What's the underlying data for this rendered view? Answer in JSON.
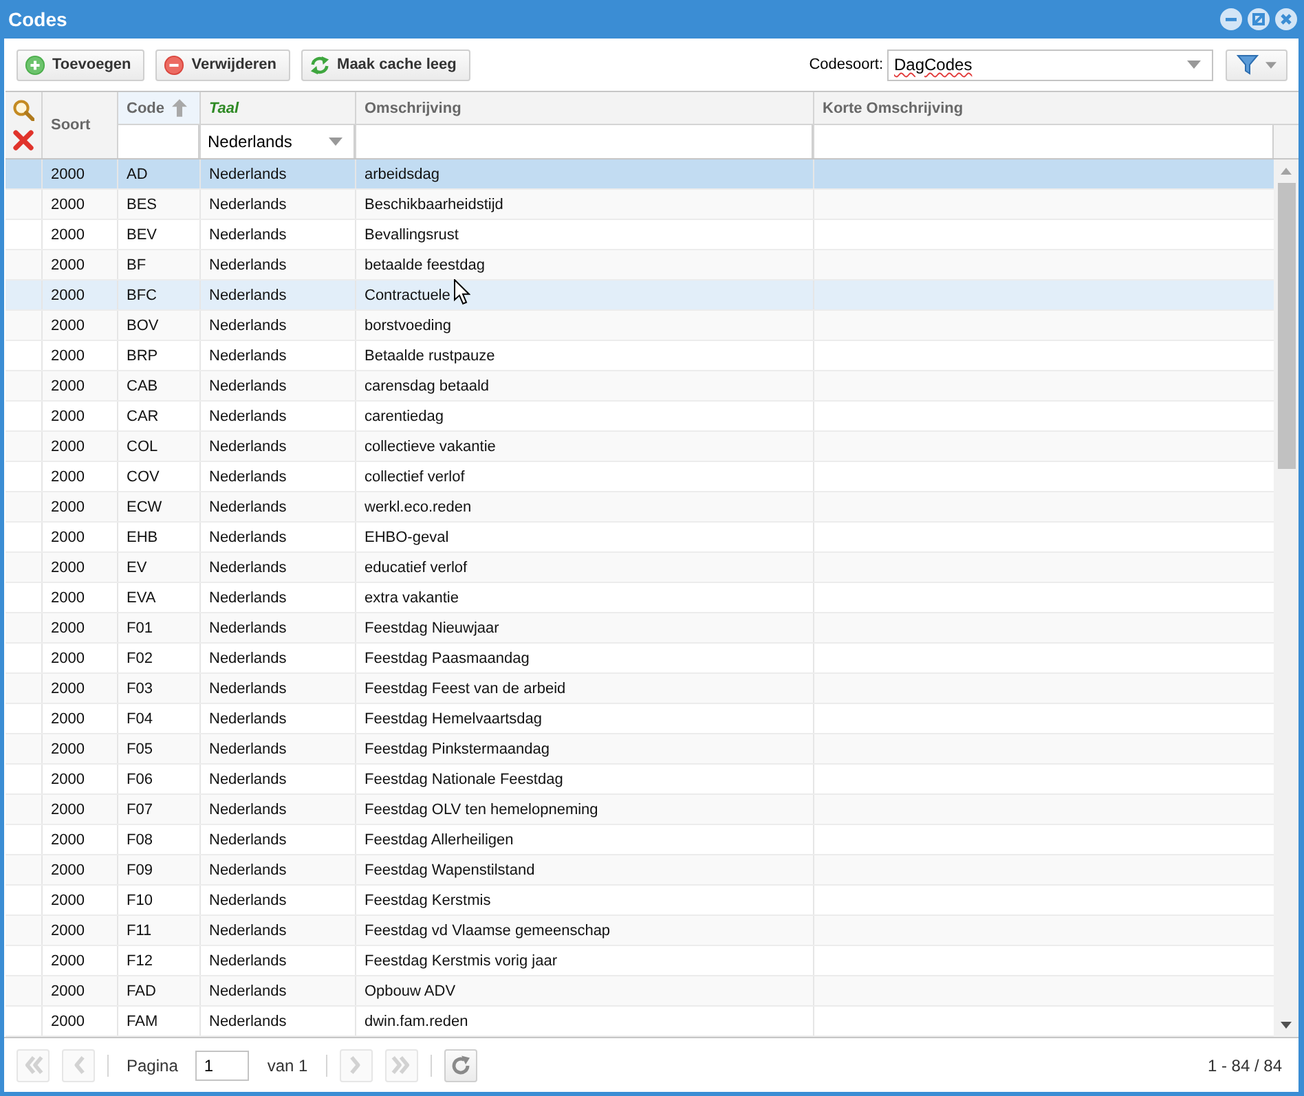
{
  "window": {
    "title": "Codes"
  },
  "toolbar": {
    "buttons": [
      {
        "label": "Toevoegen",
        "kind": "add"
      },
      {
        "label": "Verwijderen",
        "kind": "delete"
      },
      {
        "label": "Maak cache leeg",
        "kind": "refresh"
      }
    ],
    "code_type": {
      "label": "Codesoort:",
      "value": "DagCodes"
    }
  },
  "table": {
    "columns": [
      {
        "label": "Soort",
        "sorted": false,
        "filtered": false
      },
      {
        "label": "Code",
        "filter": {
          "kind": "text"
        },
        "sorted": true,
        "filtered": false
      },
      {
        "label": "Taal",
        "filter": {
          "kind": "select",
          "value": "Nederlands"
        },
        "sorted": false,
        "filtered": true
      },
      {
        "label": "Omschrijving",
        "filter": {
          "kind": "text"
        },
        "sorted": false,
        "filtered": false
      },
      {
        "label": "Korte Omschrijving",
        "filter": {
          "kind": "text"
        },
        "sorted": false,
        "filtered": false
      }
    ],
    "rows": [
      {
        "cells": [
          "2000",
          "AD",
          "Nederlands",
          "arbeidsdag"
        ],
        "selected": true,
        "hovered": false
      },
      {
        "cells": [
          "2000",
          "BES",
          "Nederlands",
          "Beschikbaarheidstijd"
        ],
        "selected": false,
        "hovered": false
      },
      {
        "cells": [
          "2000",
          "BEV",
          "Nederlands",
          "Bevallingsrust"
        ],
        "selected": false,
        "hovered": false
      },
      {
        "cells": [
          "2000",
          "BF",
          "Nederlands",
          "betaalde feestdag"
        ],
        "selected": false,
        "hovered": false
      },
      {
        "cells": [
          "2000",
          "BFC",
          "Nederlands",
          "Contractuele"
        ],
        "selected": false,
        "hovered": true
      },
      {
        "cells": [
          "2000",
          "BOV",
          "Nederlands",
          "borstvoeding"
        ],
        "selected": false,
        "hovered": false
      },
      {
        "cells": [
          "2000",
          "BRP",
          "Nederlands",
          "Betaalde rustpauze"
        ],
        "selected": false,
        "hovered": false
      },
      {
        "cells": [
          "2000",
          "CAB",
          "Nederlands",
          "carensdag betaald"
        ],
        "selected": false,
        "hovered": false
      },
      {
        "cells": [
          "2000",
          "CAR",
          "Nederlands",
          "carentiedag"
        ],
        "selected": false,
        "hovered": false
      },
      {
        "cells": [
          "2000",
          "COL",
          "Nederlands",
          "collectieve vakantie"
        ],
        "selected": false,
        "hovered": false
      },
      {
        "cells": [
          "2000",
          "COV",
          "Nederlands",
          "collectief verlof"
        ],
        "selected": false,
        "hovered": false
      },
      {
        "cells": [
          "2000",
          "ECW",
          "Nederlands",
          "werkl.eco.reden"
        ],
        "selected": false,
        "hovered": false
      },
      {
        "cells": [
          "2000",
          "EHB",
          "Nederlands",
          "EHBO-geval"
        ],
        "selected": false,
        "hovered": false
      },
      {
        "cells": [
          "2000",
          "EV",
          "Nederlands",
          "educatief verlof"
        ],
        "selected": false,
        "hovered": false
      },
      {
        "cells": [
          "2000",
          "EVA",
          "Nederlands",
          "extra vakantie"
        ],
        "selected": false,
        "hovered": false
      },
      {
        "cells": [
          "2000",
          "F01",
          "Nederlands",
          "Feestdag Nieuwjaar"
        ],
        "selected": false,
        "hovered": false
      },
      {
        "cells": [
          "2000",
          "F02",
          "Nederlands",
          "Feestdag Paasmaandag"
        ],
        "selected": false,
        "hovered": false
      },
      {
        "cells": [
          "2000",
          "F03",
          "Nederlands",
          "Feestdag Feest van de arbeid"
        ],
        "selected": false,
        "hovered": false
      },
      {
        "cells": [
          "2000",
          "F04",
          "Nederlands",
          "Feestdag Hemelvaartsdag"
        ],
        "selected": false,
        "hovered": false
      },
      {
        "cells": [
          "2000",
          "F05",
          "Nederlands",
          "Feestdag Pinkstermaandag"
        ],
        "selected": false,
        "hovered": false
      },
      {
        "cells": [
          "2000",
          "F06",
          "Nederlands",
          "Feestdag Nationale Feestdag"
        ],
        "selected": false,
        "hovered": false
      },
      {
        "cells": [
          "2000",
          "F07",
          "Nederlands",
          "Feestdag OLV ten hemelopneming"
        ],
        "selected": false,
        "hovered": false
      },
      {
        "cells": [
          "2000",
          "F08",
          "Nederlands",
          "Feestdag Allerheiligen"
        ],
        "selected": false,
        "hovered": false
      },
      {
        "cells": [
          "2000",
          "F09",
          "Nederlands",
          "Feestdag Wapenstilstand"
        ],
        "selected": false,
        "hovered": false
      },
      {
        "cells": [
          "2000",
          "F10",
          "Nederlands",
          "Feestdag Kerstmis"
        ],
        "selected": false,
        "hovered": false
      },
      {
        "cells": [
          "2000",
          "F11",
          "Nederlands",
          "Feestdag vd Vlaamse gemeenschap"
        ],
        "selected": false,
        "hovered": false
      },
      {
        "cells": [
          "2000",
          "F12",
          "Nederlands",
          "Feestdag Kerstmis vorig jaar"
        ],
        "selected": false,
        "hovered": false
      },
      {
        "cells": [
          "2000",
          "FAD",
          "Nederlands",
          "Opbouw ADV"
        ],
        "selected": false,
        "hovered": false
      },
      {
        "cells": [
          "2000",
          "FAM",
          "Nederlands",
          "dwin.fam.reden"
        ],
        "selected": false,
        "hovered": false
      }
    ]
  },
  "pager": {
    "nav": [
      {
        "kind": "first",
        "disabled": true
      },
      {
        "kind": "prev",
        "disabled": true
      },
      {
        "kind": "next",
        "disabled": true
      },
      {
        "kind": "last",
        "disabled": true
      }
    ],
    "page_label": "Pagina",
    "page": "1",
    "page_count": "van 1",
    "summary": "1 - 84 / 84"
  }
}
